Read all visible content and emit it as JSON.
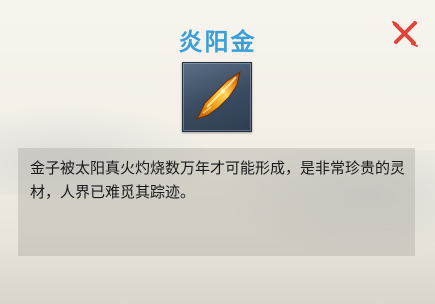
{
  "item": {
    "name": "炎阳金",
    "icon": "gold-ore-icon",
    "description": "金子被太阳真火灼烧数万年才可能形成，是非常珍贵的灵材，人界已难觅其踪迹。"
  },
  "close_icon": "close-icon",
  "colors": {
    "title": "#3a9fd8",
    "close": "#e0453a",
    "description_panel": "#b0aaa2"
  }
}
